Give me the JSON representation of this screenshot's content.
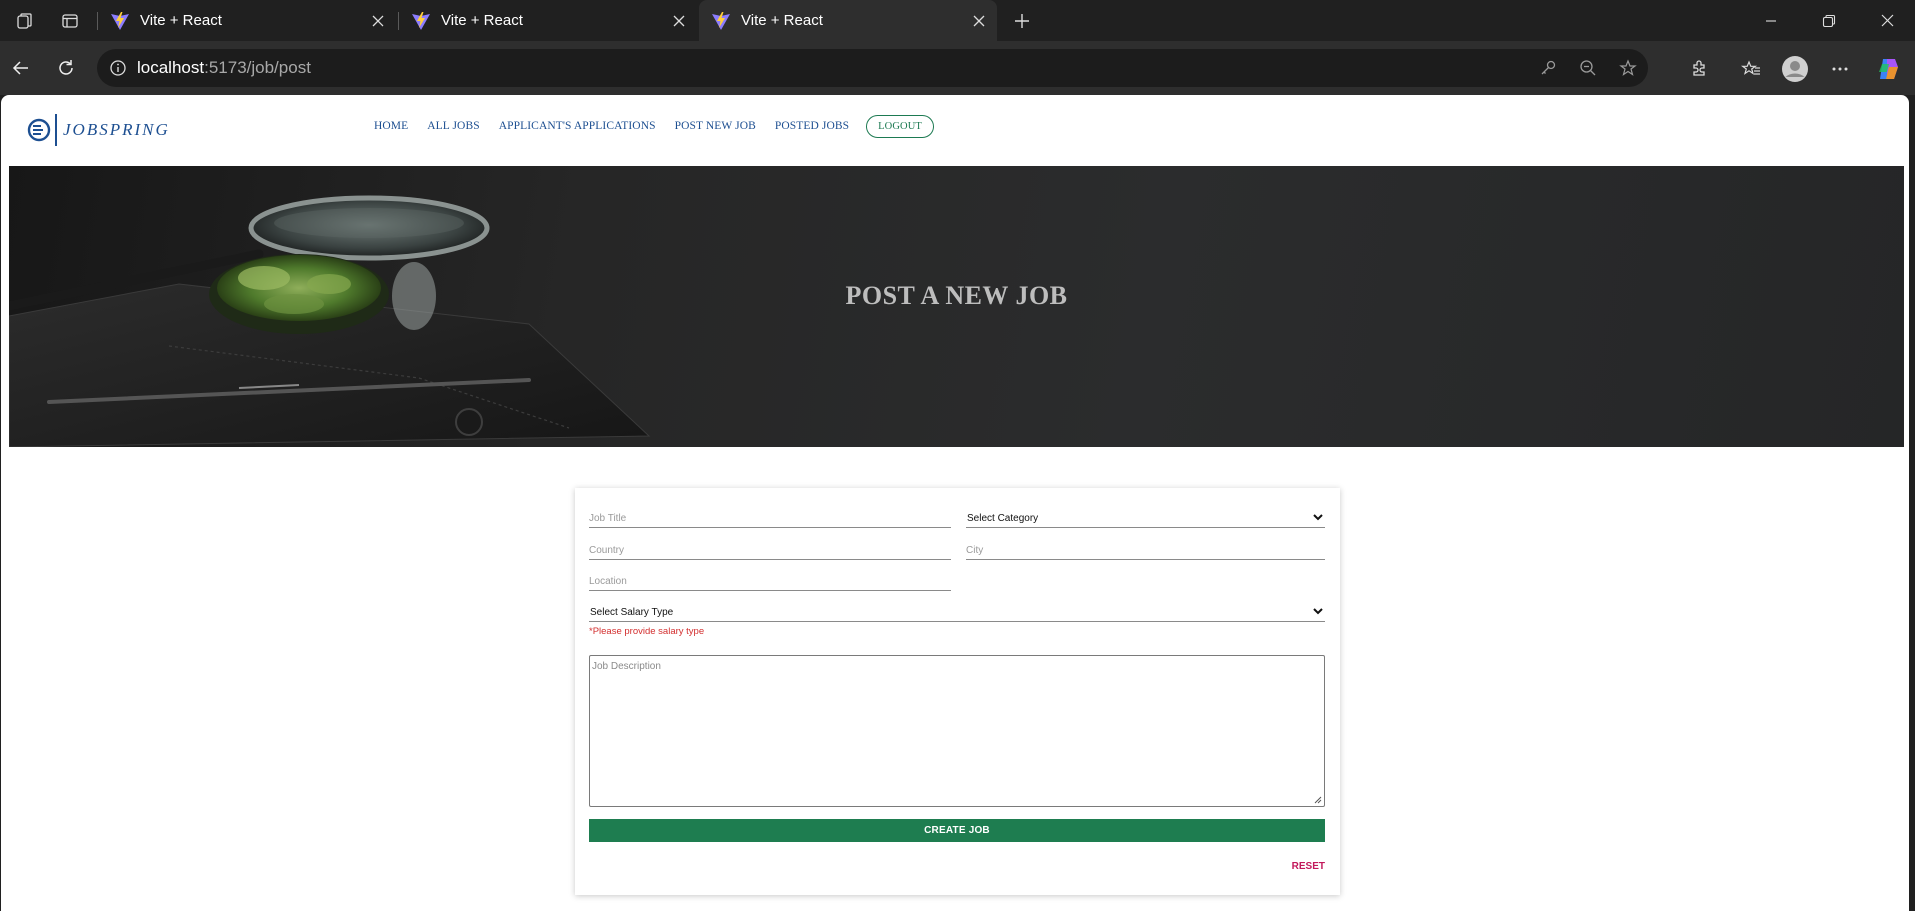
{
  "browser": {
    "tabs": [
      {
        "title": "Vite + React"
      },
      {
        "title": "Vite + React"
      },
      {
        "title": "Vite + React"
      }
    ],
    "url_host": "localhost",
    "url_path": ":5173/job/post"
  },
  "site": {
    "logo_text": "JOBSPRING",
    "nav": {
      "home": "HOME",
      "all_jobs": "ALL JOBS",
      "applications": "APPLICANT'S APPLICATIONS",
      "post_new_job": "POST NEW JOB",
      "posted_jobs": "POSTED JOBS",
      "logout": "LOGOUT"
    }
  },
  "hero": {
    "title": "POST A NEW JOB"
  },
  "form": {
    "job_title_placeholder": "Job Title",
    "category_label": "Select Category",
    "country_placeholder": "Country",
    "city_placeholder": "City",
    "location_placeholder": "Location",
    "salary_type_label": "Select Salary Type",
    "salary_error": "*Please provide salary type",
    "description_placeholder": "Job Description",
    "create_label": "CREATE JOB",
    "reset_label": "RESET"
  },
  "colors": {
    "brand_blue": "#1d4f91",
    "primary_green": "#1e7d50",
    "error_red": "#d32f2f",
    "reset_pink": "#c2185b"
  }
}
